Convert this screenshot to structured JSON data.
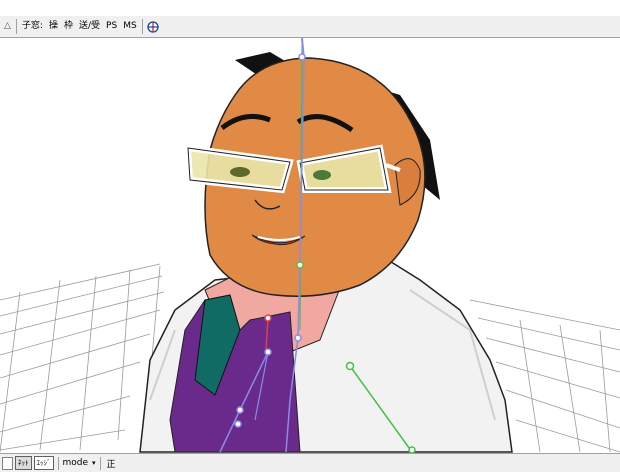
{
  "toolbar": {
    "arrow": "△",
    "items": [
      "子窓:",
      "操",
      "枠",
      "送/受",
      "PS",
      "MS"
    ],
    "icon": "crosshair-icon"
  },
  "bottombar": {
    "buttons": [
      "ﾈｯﾄ",
      "ｴｯｼﾞ"
    ],
    "mode_label": "mode",
    "mode_arrow": "▾",
    "right_label": "正"
  },
  "colors": {
    "skin": "#e08a46",
    "hair": "#111111",
    "glasses_frame": "#ffffff",
    "lens": "#e9e6a8",
    "coat": "#f2f2f2",
    "shirt": "#f0a8a0",
    "vest": "#6a2a8c",
    "tie": "#0f6b63",
    "bone_blue": "#8a8ae8",
    "bone_green": "#40c040",
    "bone_red": "#e04040",
    "grid": "#9a9a9a"
  }
}
